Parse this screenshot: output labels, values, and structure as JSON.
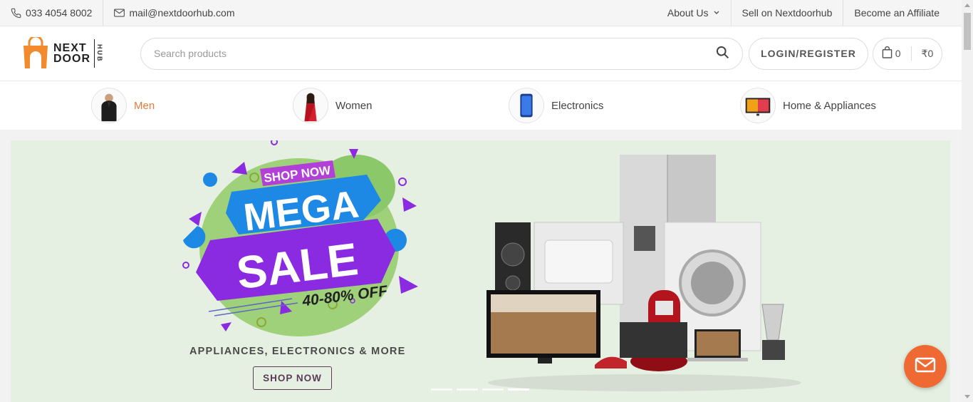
{
  "topbar": {
    "phone": "033 4054 8002",
    "email": "mail@nextdoorhub.com",
    "about_label": "About Us",
    "sell_label": "Sell on Nextdoorhub",
    "affiliate_label": "Become an Affiliate"
  },
  "logo": {
    "line1": "NEXT",
    "line2": "DOOR",
    "side": "HUB"
  },
  "search": {
    "placeholder": "Search products",
    "value": ""
  },
  "header": {
    "login_label": "LOGIN/REGISTER",
    "cart_count": "0",
    "cart_total": "₹0"
  },
  "categories": [
    {
      "label": "Men",
      "active": true
    },
    {
      "label": "Women",
      "active": false
    },
    {
      "label": "Electronics",
      "active": false
    },
    {
      "label": "Home & Appliances",
      "active": false
    }
  ],
  "banner": {
    "shop_now_tag": "SHOP NOW",
    "headline_1": "MEGA",
    "headline_2": "SALE",
    "discount": "40-80% OFF",
    "tagline": "APPLIANCES, ELECTRONICS & MORE",
    "button_label": "SHOP NOW",
    "slides_total": 4,
    "active_slide": 4
  },
  "colors": {
    "accent": "#e8793a",
    "logo_orange": "#f28a2e",
    "banner_bg": "#e6f0e2",
    "sale_purple": "#8a2be2",
    "sale_blue": "#1e88e5",
    "chat_fab": "#ef6a32"
  },
  "icons": {
    "phone": "phone-icon",
    "email": "mail-icon",
    "about_dropdown": "chevron-down-icon",
    "search": "search-icon",
    "cart": "shopping-bag-icon",
    "chat": "mail-icon"
  }
}
